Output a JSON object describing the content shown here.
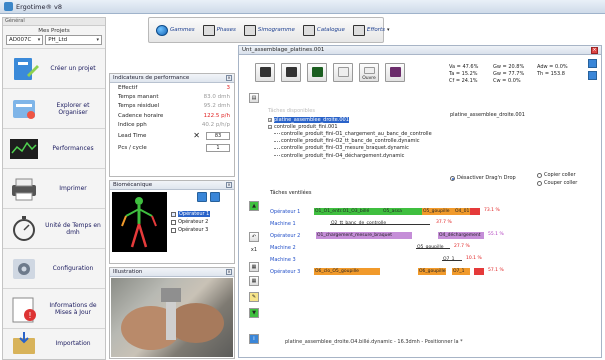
{
  "window": {
    "title": "Ergotime® v8"
  },
  "toolbar": {
    "items": [
      {
        "label": "Gammes",
        "icon": "globe-icon"
      },
      {
        "label": "Phases",
        "icon": "phases-icon"
      },
      {
        "label": "Simogramme",
        "icon": "simogramme-icon"
      },
      {
        "label": "Catalogue",
        "icon": "catalogue-icon"
      },
      {
        "label": "Efforts",
        "icon": "efforts-icon"
      }
    ]
  },
  "sidebar": {
    "header": "Général",
    "projects_title": "Mes Projets",
    "project_select": "AD007C",
    "product_select": "PH_Ltd",
    "items": [
      {
        "label": "Créer un projet",
        "icon": "create-project-icon"
      },
      {
        "label": "Explorer et Organiser",
        "icon": "explore-icon"
      },
      {
        "label": "Performances",
        "icon": "performance-chart-icon"
      },
      {
        "label": "Imprimer",
        "icon": "printer-icon"
      },
      {
        "label": "Unité de Temps en dmh",
        "icon": "stopwatch-icon"
      },
      {
        "label": "Configuration",
        "icon": "configuration-icon"
      },
      {
        "label": "Informations de Mises à Jour",
        "icon": "update-info-icon"
      },
      {
        "label": "Importation",
        "icon": "import-icon"
      }
    ]
  },
  "performance": {
    "title": "Indicateurs de performance",
    "rows": [
      {
        "label": "Effectif",
        "value": "3",
        "red": true
      },
      {
        "label": "Temps manant",
        "value": "83.0 dmh",
        "red": false
      },
      {
        "label": "Temps résiduel",
        "value": "95.2 dmh",
        "red": false
      },
      {
        "label": "Cadence horaire",
        "value": "122.5 p/h",
        "red": true
      },
      {
        "label": "Indice pph",
        "value": "40.2 p/h/p",
        "red": false
      }
    ],
    "lead_time_label": "Lead Time",
    "lead_time_value": "83",
    "pcs_label": "Pcs / cycle",
    "pcs_value": "1"
  },
  "biomecanique": {
    "title": "Biomécanique",
    "operators": [
      "Opérateur 1",
      "Opérateur 2",
      "Opérateur 3"
    ]
  },
  "illustration": {
    "title": "Illustration"
  },
  "main": {
    "title": "Unt_assemblage_platines.001",
    "tool_labels": [
      "",
      "",
      "",
      "",
      "Ouvre",
      ""
    ],
    "stats": [
      [
        "Va = 47.6%",
        "Gw = 20.8%",
        "Adw = 0.0%"
      ],
      [
        "Ta = 15.2%",
        "Gw = 77.7%",
        "Th = 153.8"
      ],
      [
        "Cf = 24.1%",
        "Cw = 0.0%",
        ""
      ]
    ],
    "tree_hint": "Tâches disponibles",
    "tree": [
      {
        "label": "platine_assemblee_droite.001",
        "level": 0,
        "selected": true
      },
      {
        "label": "controlle_produit_fini.001",
        "level": 0,
        "selected": false
      },
      {
        "label": "controlle_produit_fini-O1_chargement_au_banc_de_controlle",
        "level": 1,
        "selected": false
      },
      {
        "label": "controlle_produit_fini-O2_tt_banc_de_controlle.dynamic",
        "level": 1,
        "selected": false
      },
      {
        "label": "controlle_produit_fini-O3_mesure_braquet.dynamic",
        "level": 1,
        "selected": false
      },
      {
        "label": "controlle_produit_fini-O4_déchargement.dynamic",
        "level": 1,
        "selected": false
      }
    ],
    "tree_right_label": "platine_assemblee_droite.001",
    "option_drag": "Désactiver Drag'n Drop",
    "option_copy": "Copier coller",
    "option_cut": "Couper coller",
    "ventilated_label": "Tâches ventilées",
    "gantt": [
      {
        "label": "Opérateur 1",
        "bars": [
          {
            "text": "O1_O1_entr.O1_O3_billé",
            "color": "green"
          },
          {
            "text": "O5_assa",
            "color": "green"
          },
          {
            "text": "O5_goupille",
            "color": "orange"
          },
          {
            "text": "O4_01",
            "color": "orange"
          },
          {
            "text": "",
            "color": "red"
          }
        ],
        "pct": "73.1 %"
      },
      {
        "label": "Machine 1",
        "bars": [
          {
            "text": "O2_tt_banc_de_controlle",
            "color": "line"
          }
        ],
        "pct": "37.7 %"
      },
      {
        "label": "Opérateur 2",
        "bars": [
          {
            "text": "O1_chargement_mesure_braquet",
            "color": "purple"
          },
          {
            "text": "O4_déchargement",
            "color": "purple"
          }
        ],
        "pct": "55.1 %"
      },
      {
        "label": "Machine 2",
        "bars": [
          {
            "text": "O5_goupille",
            "color": "line"
          }
        ],
        "pct": "27.7 %"
      },
      {
        "label": "Machine 3",
        "bars": [
          {
            "text": "O7_1",
            "color": "line"
          }
        ],
        "pct": "10.1 %"
      },
      {
        "label": "Opérateur 3",
        "bars": [
          {
            "text": "O6_clo_O5_goupille",
            "color": "orange"
          },
          {
            "text": "O6_goupille",
            "color": "orange"
          },
          {
            "text": "O7_1",
            "color": "orange"
          },
          {
            "text": "",
            "color": "red"
          }
        ],
        "pct": "57.1 %"
      }
    ],
    "status": "platine_assemblee_droite.O4.billé.dynamic - 16.3dmh - Positionner la *"
  }
}
